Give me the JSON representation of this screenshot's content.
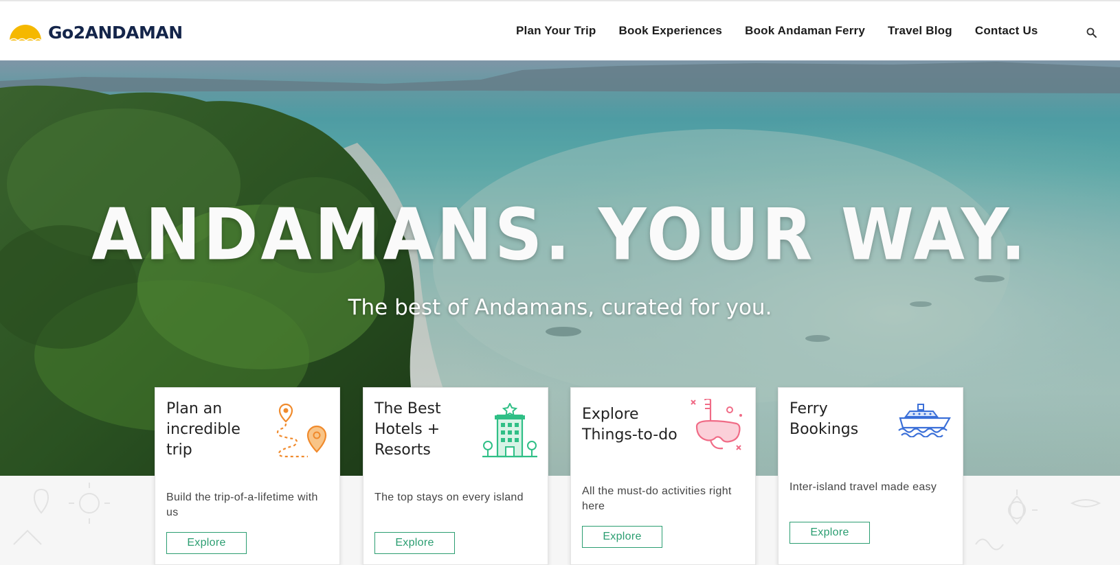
{
  "brand": {
    "name": "Go2ANDAMAN",
    "logo_icon": "half-sun-icon",
    "logo_color": "#f5b800",
    "text_color": "#14254a"
  },
  "nav": {
    "items": [
      {
        "label": "Plan Your Trip"
      },
      {
        "label": "Book Experiences"
      },
      {
        "label": "Book Andaman Ferry"
      },
      {
        "label": "Travel Blog"
      },
      {
        "label": "Contact Us"
      }
    ],
    "search_icon": "search-icon"
  },
  "hero": {
    "title": "ANDAMANS. YOUR WAY.",
    "subtitle": "The best of Andamans, curated for you."
  },
  "cards": [
    {
      "title": "Plan an\nincredible\ntrip",
      "description": "Build the trip-of-a-lifetime with us",
      "button": "Explore",
      "icon": "map-pins-route-icon",
      "icon_color": "#f08a2c"
    },
    {
      "title": "The Best\nHotels +\nResorts",
      "description": "The top stays on every island",
      "button": "Explore",
      "icon": "hotel-building-icon",
      "icon_color": "#2fbf86"
    },
    {
      "title": "Explore\nThings-to-do",
      "description": "All the must-do activities right here",
      "button": "Explore",
      "icon": "snorkel-mask-icon",
      "icon_color": "#f06b86"
    },
    {
      "title": "Ferry\nBookings",
      "description": "Inter-island travel made easy",
      "button": "Explore",
      "icon": "ferry-ship-icon",
      "icon_color": "#3a6fd8"
    }
  ],
  "colors": {
    "accent_green": "#2a9d70"
  }
}
